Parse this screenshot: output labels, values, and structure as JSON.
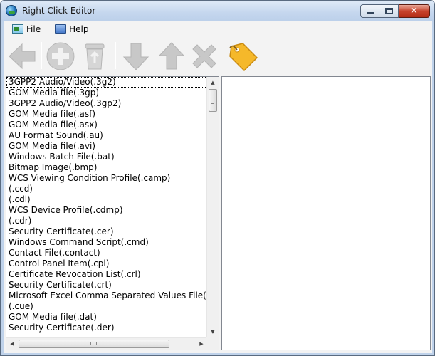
{
  "window": {
    "title": "Right Click Editor",
    "icons": {
      "app": "globe-icon",
      "minimize": "minimize-icon",
      "maximize": "maximize-icon",
      "close": "close-icon"
    },
    "close_glyph": "✕"
  },
  "menu": {
    "items": [
      {
        "label": "File",
        "icon": "file-menu-icon"
      },
      {
        "label": "Help",
        "icon": "help-book-icon"
      }
    ]
  },
  "toolbar": {
    "buttons": [
      {
        "name": "back",
        "icon": "left-arrow-icon",
        "enabled": false
      },
      {
        "name": "add",
        "icon": "plus-circle-icon",
        "enabled": false
      },
      {
        "name": "delete",
        "icon": "recycle-bin-icon",
        "enabled": false
      },
      {
        "name": "move-down",
        "icon": "down-arrow-icon",
        "enabled": false
      },
      {
        "name": "move-up",
        "icon": "up-arrow-icon",
        "enabled": false
      },
      {
        "name": "remove",
        "icon": "x-icon",
        "enabled": false
      },
      {
        "name": "tag",
        "icon": "tag-icon",
        "enabled": true
      }
    ],
    "colors": {
      "disabled": "#c8c8c8",
      "tag": "#f5b82a"
    }
  },
  "file_types": {
    "focused_index": 0,
    "items": [
      "3GPP2 Audio/Video(.3g2)",
      "GOM Media file(.3gp)",
      "3GPP2 Audio/Video(.3gp2)",
      "GOM Media file(.asf)",
      "GOM Media file(.asx)",
      "AU Format Sound(.au)",
      "GOM Media file(.avi)",
      "Windows Batch File(.bat)",
      "Bitmap Image(.bmp)",
      "WCS Viewing Condition Profile(.camp)",
      "(.ccd)",
      "(.cdi)",
      "WCS Device Profile(.cdmp)",
      "(.cdr)",
      "Security Certificate(.cer)",
      "Windows Command Script(.cmd)",
      "Contact File(.contact)",
      "Control Panel Item(.cpl)",
      "Certificate Revocation List(.crl)",
      "Security Certificate(.crt)",
      "Microsoft Excel Comma Separated Values File(.csv)",
      "(.cue)",
      "GOM Media file(.dat)",
      "Security Certificate(.der)"
    ]
  },
  "scrollbars": {
    "up_glyph": "▲",
    "down_glyph": "▼",
    "left_glyph": "◀",
    "right_glyph": "▶"
  }
}
